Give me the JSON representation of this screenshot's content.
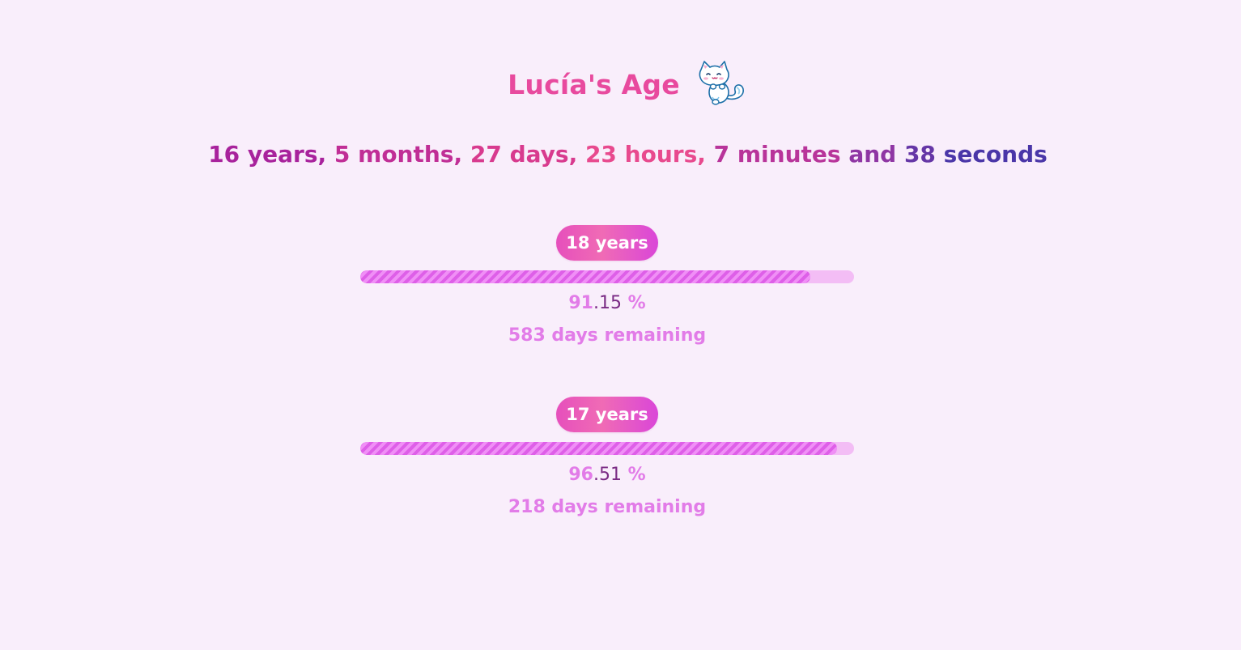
{
  "header": {
    "title": "Lucía's Age",
    "icon": "cat-icon"
  },
  "age": {
    "years": "16 years,",
    "months": "5 months,",
    "days": "27 days,",
    "hours": "23 hours,",
    "minutes": "7 minutes",
    "and": "and",
    "seconds_num": "38",
    "seconds_word": "seconds"
  },
  "milestones": [
    {
      "label": "18 years",
      "progress": 0.9115,
      "percent_int": "91",
      "percent_dec": ".15",
      "percent_sym": "%",
      "remaining": "583 days remaining"
    },
    {
      "label": "17 years",
      "progress": 0.9651,
      "percent_int": "96",
      "percent_dec": ".51",
      "percent_sym": "%",
      "remaining": "218 days remaining"
    }
  ],
  "colors": {
    "background": "#f9eefb",
    "title": "#e84a9e",
    "accent_pink": "#e27ce8",
    "bar_track": "#f3bdf5"
  }
}
